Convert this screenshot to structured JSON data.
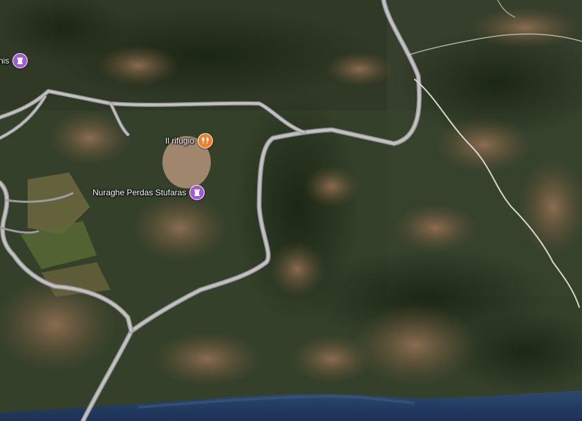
{
  "map": {
    "type": "satellite",
    "colors": {
      "road": "#b9b9b9",
      "road_edge": "#8d8d8d",
      "trail": "#d8d8d0",
      "sea": "#223a62",
      "vegetation_dark": "#243018",
      "vegetation_mid": "#3e4a2a",
      "bare_earth": "#8a6a4e",
      "monument_pin": "#a459d6",
      "restaurant_pin": "#f07f24"
    }
  },
  "pois": [
    {
      "id": "partial",
      "label": "nis",
      "icon": "monument-icon",
      "kind": "historical-site"
    },
    {
      "id": "rifugio",
      "label": "Il rifugio",
      "icon": "restaurant-icon",
      "kind": "restaurant"
    },
    {
      "id": "nuraghe",
      "label": "Nuraghe Perdas Stufaras",
      "icon": "monument-icon",
      "kind": "historical-site"
    }
  ]
}
